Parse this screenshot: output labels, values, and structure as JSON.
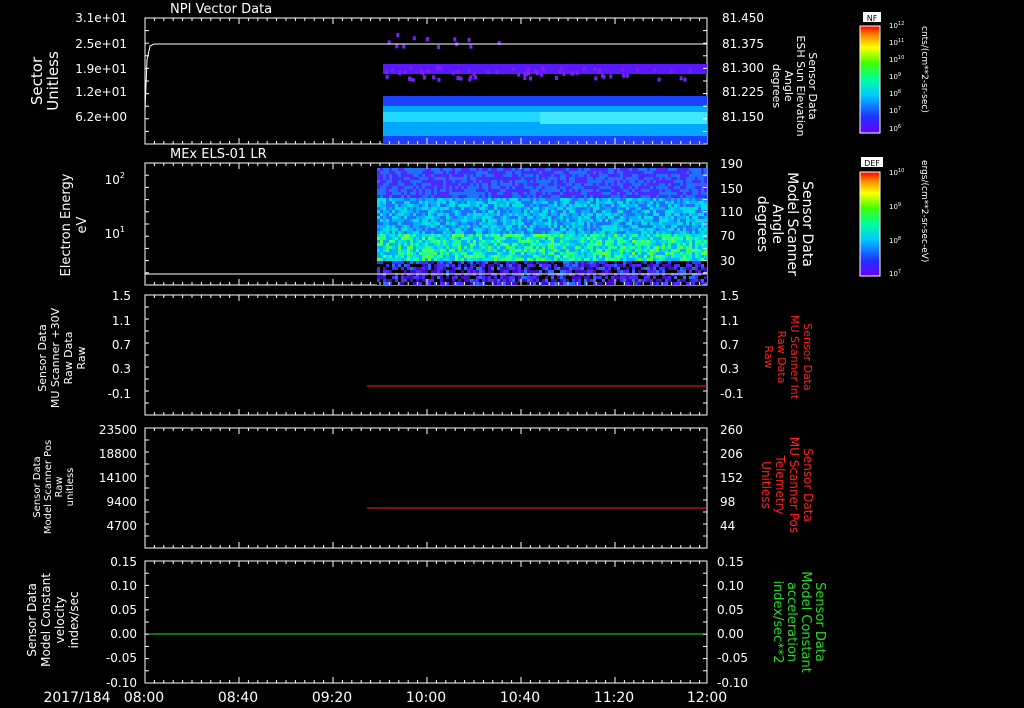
{
  "date_label": "2017/184",
  "time_ticks": [
    "08:00",
    "08:40",
    "09:20",
    "10:00",
    "10:40",
    "11:20",
    "12:00"
  ],
  "colors": {
    "red": "#ff2020",
    "green": "#22dd22",
    "white": "#ffffff"
  },
  "panels": [
    {
      "id": "npi",
      "title": "NPI Vector Data",
      "left_label": [
        "Sector",
        "Unitless"
      ],
      "left_ticks": [
        "3.1e+01",
        "2.5e+01",
        "1.9e+01",
        "1.2e+01",
        "6.2e+00"
      ],
      "right_ticks": [
        "81.450",
        "81.375",
        "81.300",
        "81.225",
        "81.150"
      ],
      "right_label": [
        "Sensor Data",
        "ESH Sun Elevation",
        "Angle",
        "degrees"
      ],
      "right_color": "#ffffff"
    },
    {
      "id": "els",
      "title": "MEx ELS-01 LR",
      "left_label": [
        "Electron Energy",
        "eV"
      ],
      "left_ticks": [
        "10",
        "10",
        "10"
      ],
      "left_tick_exp": [
        "2",
        "1",
        ""
      ],
      "right_ticks": [
        "190",
        "150",
        "110",
        "70",
        "30"
      ],
      "right_label": [
        "Sensor Data",
        "Model Scanner",
        "Angle",
        "degrees"
      ],
      "right_color": "#ffffff"
    },
    {
      "id": "mu30",
      "title": "",
      "left_label": [
        "Sensor Data",
        "MU Scanner +30V",
        "Raw Data",
        "Raw"
      ],
      "left_ticks": [
        "1.5",
        "1.1",
        "0.7",
        "0.3",
        "-0.1"
      ],
      "right_ticks": [
        "1.5",
        "1.1",
        "0.7",
        "0.3",
        "-0.1"
      ],
      "right_label": [
        "Sensor Data",
        "MU Scanner Int",
        "Raw Data",
        "Raw"
      ],
      "right_color": "#ff2020"
    },
    {
      "id": "pos",
      "title": "",
      "left_label": [
        "Sensor Data",
        "Model Scanner Pos",
        "Raw",
        "unitless"
      ],
      "left_ticks": [
        "23500",
        "18800",
        "14100",
        "9400",
        "4700"
      ],
      "right_ticks": [
        "260",
        "206",
        "152",
        "98",
        "44"
      ],
      "right_label": [
        "Sensor Data",
        "MU Scanner Pos",
        "Telemetry",
        "Unitless"
      ],
      "right_color": "#ff2020"
    },
    {
      "id": "vel",
      "title": "",
      "left_label": [
        "Sensor Data",
        "Model Constant",
        "velocity",
        "index/sec"
      ],
      "left_ticks": [
        "0.15",
        "0.10",
        "0.05",
        "0.00",
        "-0.05",
        "-0.10"
      ],
      "right_ticks": [
        "0.15",
        "0.10",
        "0.05",
        "0.00",
        "-0.05",
        "-0.10"
      ],
      "right_label": [
        "Sensor Data",
        "Model Constant",
        "acceleration",
        "index/sec**2"
      ],
      "right_color": "#22dd22"
    }
  ],
  "colorbars": [
    {
      "id": "nf",
      "title": "NF",
      "top_exp": "12",
      "ticks": [
        [
          "10",
          "12"
        ],
        [
          "10",
          "11"
        ],
        [
          "10",
          "10"
        ],
        [
          "10",
          "9"
        ],
        [
          "10",
          "8"
        ],
        [
          "10",
          "7"
        ],
        [
          "10",
          "6"
        ]
      ],
      "unit": "cnts/(cm**2-sr-sec)"
    },
    {
      "id": "def",
      "title": "DEF",
      "ticks": [
        [
          "10",
          "10"
        ],
        [
          "10",
          "9"
        ],
        [
          "10",
          "8"
        ],
        [
          "10",
          "7"
        ]
      ],
      "unit": "ergs/(cm**2-sr-sec-eV)"
    }
  ],
  "chart_data": {
    "type": "line",
    "x_range": [
      "08:00",
      "12:00"
    ],
    "series": [
      {
        "panel": "npi",
        "kind": "line",
        "color": "#ffffff",
        "x": [
          "08:00",
          "08:01",
          "08:02",
          "12:00"
        ],
        "y": [
          6.2,
          23.5,
          25.4,
          25.4
        ]
      },
      {
        "panel": "npi",
        "kind": "spectrogram",
        "start": "09:32",
        "end": "12:00"
      },
      {
        "panel": "els",
        "kind": "spectrogram",
        "start": "09:29",
        "end": "12:00"
      },
      {
        "panel": "els",
        "kind": "line",
        "color": "#ffffff",
        "x": [
          "08:00",
          "12:00"
        ],
        "y": [
          18,
          18
        ],
        "axis": "right"
      },
      {
        "panel": "mu30",
        "kind": "line",
        "color": "#ff2020",
        "x": [
          "09:25",
          "12:00"
        ],
        "y": [
          0.0,
          0.0
        ],
        "axis": "right"
      },
      {
        "panel": "pos",
        "kind": "line",
        "color": "#ff2020",
        "x": [
          "09:25",
          "12:00"
        ],
        "y": [
          84,
          84
        ],
        "axis": "right"
      },
      {
        "panel": "vel",
        "kind": "line",
        "color": "#22dd22",
        "x": [
          "08:00",
          "12:00"
        ],
        "y": [
          0.0,
          0.0
        ]
      }
    ]
  }
}
